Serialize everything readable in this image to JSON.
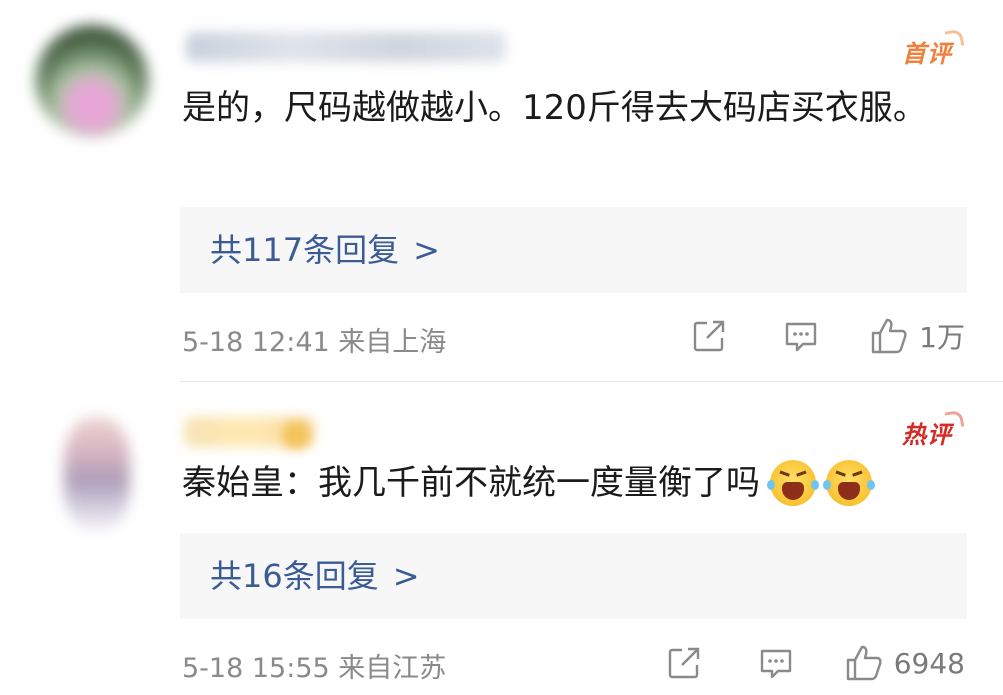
{
  "comments": [
    {
      "badge": "首评",
      "text": "是的，尺码越做越小。120斤得去大码店买衣服。",
      "replies_label": "共117条回复",
      "replies_chevron": ">",
      "date": "5-18 12:41",
      "location": "来自上海",
      "like_count": "1万"
    },
    {
      "badge": "热评",
      "text": "秦始皇：我几千前不就统一度量衡了吗",
      "emoji": [
        "scream-cry-emoji",
        "scream-cry-emoji"
      ],
      "replies_label": "共16条回复",
      "replies_chevron": ">",
      "date": "5-18 15:55",
      "location": "来自江苏",
      "like_count": "6948"
    }
  ],
  "colors": {
    "first_badge": "#ef7f3b",
    "hot_badge": "#d42b26",
    "reply_link": "#3b5b95",
    "reply_bg": "#f7f7f7",
    "meta_text": "#8a8a8a"
  },
  "icons": {
    "share": "share-icon",
    "comment": "comment-icon",
    "like": "thumbs-up-icon"
  }
}
